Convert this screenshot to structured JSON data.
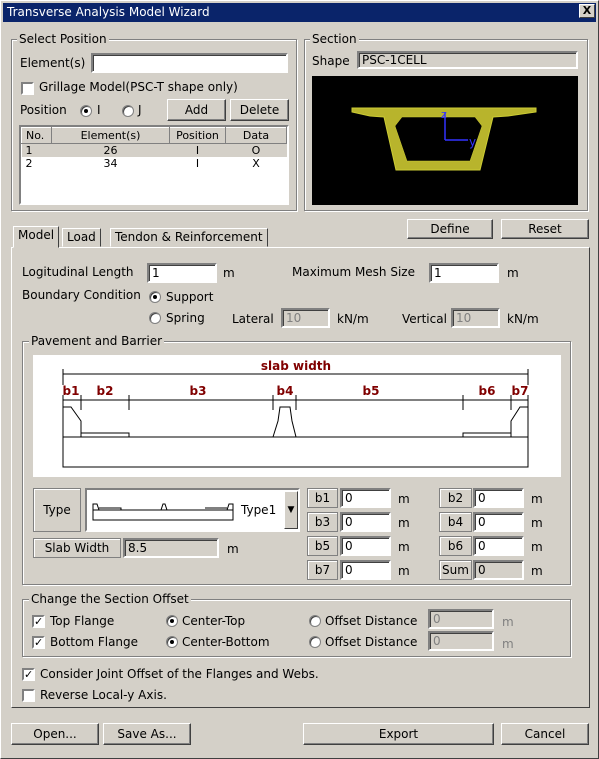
{
  "window": {
    "title": "Transverse Analysis Model Wizard",
    "close": "X"
  },
  "select_position": {
    "title": "Select Position",
    "elements_label": "Element(s)",
    "elements_value": "",
    "grillage_label": "Grillage Model(PSC-T shape only)",
    "grillage_checked": false,
    "position_label": "Position",
    "pos_i": "I",
    "pos_j": "J",
    "pos_selected": "I",
    "add_label": "Add",
    "delete_label": "Delete",
    "columns": [
      "No.",
      "Element(s)",
      "Position",
      "Data"
    ],
    "rows": [
      {
        "no": "1",
        "element": "26",
        "position": "I",
        "data": "O"
      },
      {
        "no": "2",
        "element": "34",
        "position": "I",
        "data": "X"
      }
    ]
  },
  "section": {
    "title": "Section",
    "shape_label": "Shape",
    "shape_value": "PSC-1CELL",
    "axis_z": "z",
    "axis_y": "y",
    "colors": {
      "bg": "#000000",
      "shape": "#cccc33",
      "axis": "#3333ff"
    }
  },
  "define_label": "Define",
  "reset_label": "Reset",
  "tabs": [
    "Model",
    "Load",
    "Tendon & Reinforcement"
  ],
  "model": {
    "long_length_label": "Logitudinal Length",
    "long_length_value": "1",
    "long_length_unit": "m",
    "max_mesh_label": "Maximum Mesh Size",
    "max_mesh_value": "1",
    "max_mesh_unit": "m",
    "boundary_label": "Boundary Condition",
    "support_label": "Support",
    "spring_label": "Spring",
    "lateral_label": "Lateral",
    "lateral_value": "10",
    "lateral_unit": "kN/m",
    "vertical_label": "Vertical",
    "vertical_value": "10",
    "vertical_unit": "kN/m"
  },
  "pavement": {
    "title": "Pavement and Barrier",
    "slab_width": "slab width",
    "dims": [
      "b1",
      "b2",
      "b3",
      "b4",
      "b5",
      "b6",
      "b7"
    ],
    "type_label": "Type",
    "type_value": "Type1",
    "slab_width_label": "Slab Width",
    "slab_width_value": "8.5",
    "slab_width_unit": "m",
    "fields": [
      {
        "label": "b1",
        "value": "0",
        "unit": "m"
      },
      {
        "label": "b2",
        "value": "0",
        "unit": "m"
      },
      {
        "label": "b3",
        "value": "0",
        "unit": "m"
      },
      {
        "label": "b4",
        "value": "0",
        "unit": "m"
      },
      {
        "label": "b5",
        "value": "0",
        "unit": "m"
      },
      {
        "label": "b6",
        "value": "0",
        "unit": "m"
      },
      {
        "label": "b7",
        "value": "0",
        "unit": "m"
      },
      {
        "label": "Sum",
        "value": "0",
        "unit": "m"
      }
    ]
  },
  "offset": {
    "title": "Change the Section Offset",
    "top_flange": "Top Flange",
    "bottom_flange": "Bottom Flange",
    "center_top": "Center-Top",
    "center_bottom": "Center-Bottom",
    "offset_distance": "Offset Distance",
    "offset_value": "0",
    "unit": "m"
  },
  "joint_offset_label": "Consider Joint Offset of the Flanges and Webs.",
  "reverse_label": "Reverse Local-y Axis.",
  "footer": {
    "open": "Open...",
    "saveas": "Save As...",
    "export": "Export",
    "cancel": "Cancel"
  }
}
